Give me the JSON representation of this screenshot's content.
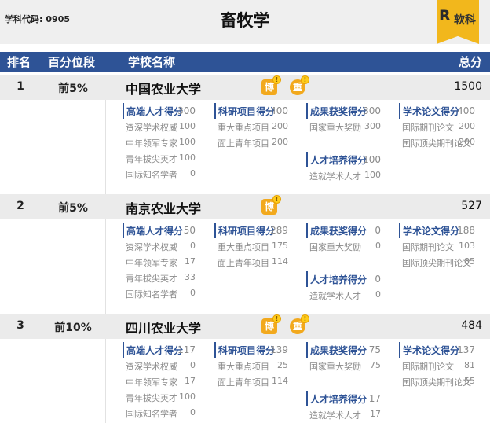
{
  "header": {
    "code_label": "学科代码:",
    "code_value": "0905",
    "title": "畜牧学",
    "logo_text": "软科"
  },
  "columns": {
    "rank": "排名",
    "percentile": "百分位段",
    "school": "学校名称",
    "total": "总分"
  },
  "schools": [
    {
      "rank": "1",
      "percentile": "前5%",
      "name": "中国农业大学",
      "total": "1500",
      "badges": [
        {
          "text": "博",
          "dot": "!"
        },
        {
          "text": "重",
          "dot": "!"
        }
      ],
      "talent": {
        "name": "高端人才得分",
        "score": "300",
        "items": [
          {
            "name": "资深学术权威",
            "score": "100"
          },
          {
            "name": "中年领军专家",
            "score": "100"
          },
          {
            "name": "青年拔尖英才",
            "score": "100"
          },
          {
            "name": "国际知名学者",
            "score": "0"
          }
        ]
      },
      "research": {
        "name": "科研项目得分",
        "score": "400",
        "items": [
          {
            "name": "重大重点项目",
            "score": "200"
          },
          {
            "name": "面上青年项目",
            "score": "200"
          }
        ]
      },
      "award": {
        "name": "成果获奖得分",
        "score": "300",
        "items": [
          {
            "name": "国家重大奖励",
            "score": "300"
          }
        ]
      },
      "training": {
        "name": "人才培养得分",
        "score": "100",
        "items": [
          {
            "name": "造就学术人才",
            "score": "100"
          }
        ]
      },
      "papers": {
        "name": "学术论文得分",
        "score": "400",
        "items": [
          {
            "name": "国际期刊论文",
            "score": "200"
          },
          {
            "name": "国际顶尖期刊论文",
            "score": "200"
          }
        ]
      }
    },
    {
      "rank": "2",
      "percentile": "前5%",
      "name": "南京农业大学",
      "total": "527",
      "badges": [
        {
          "text": "博",
          "dot": "!"
        }
      ],
      "talent": {
        "name": "高端人才得分",
        "score": "50",
        "items": [
          {
            "name": "资深学术权威",
            "score": "0"
          },
          {
            "name": "中年领军专家",
            "score": "17"
          },
          {
            "name": "青年拔尖英才",
            "score": "33"
          },
          {
            "name": "国际知名学者",
            "score": "0"
          }
        ]
      },
      "research": {
        "name": "科研项目得分",
        "score": "289",
        "items": [
          {
            "name": "重大重点项目",
            "score": "175"
          },
          {
            "name": "面上青年项目",
            "score": "114"
          }
        ]
      },
      "award": {
        "name": "成果获奖得分",
        "score": "0",
        "items": [
          {
            "name": "国家重大奖励",
            "score": "0"
          }
        ]
      },
      "training": {
        "name": "人才培养得分",
        "score": "0",
        "items": [
          {
            "name": "造就学术人才",
            "score": "0"
          }
        ]
      },
      "papers": {
        "name": "学术论文得分",
        "score": "188",
        "items": [
          {
            "name": "国际期刊论文",
            "score": "103"
          },
          {
            "name": "国际顶尖期刊论文",
            "score": "85"
          }
        ]
      }
    },
    {
      "rank": "3",
      "percentile": "前10%",
      "name": "四川农业大学",
      "total": "484",
      "badges": [
        {
          "text": "博",
          "dot": "!"
        },
        {
          "text": "重",
          "dot": "!"
        }
      ],
      "talent": {
        "name": "高端人才得分",
        "score": "117",
        "items": [
          {
            "name": "资深学术权威",
            "score": "0"
          },
          {
            "name": "中年领军专家",
            "score": "17"
          },
          {
            "name": "青年拔尖英才",
            "score": "100"
          },
          {
            "name": "国际知名学者",
            "score": "0"
          }
        ]
      },
      "research": {
        "name": "科研项目得分",
        "score": "139",
        "items": [
          {
            "name": "重大重点项目",
            "score": "25"
          },
          {
            "name": "面上青年项目",
            "score": "114"
          }
        ]
      },
      "award": {
        "name": "成果获奖得分",
        "score": "75",
        "items": [
          {
            "name": "国家重大奖励",
            "score": "75"
          }
        ]
      },
      "training": {
        "name": "人才培养得分",
        "score": "17",
        "items": [
          {
            "name": "造就学术人才",
            "score": "17"
          }
        ]
      },
      "papers": {
        "name": "学术论文得分",
        "score": "137",
        "items": [
          {
            "name": "国际期刊论文",
            "score": "81"
          },
          {
            "name": "国际顶尖期刊论文",
            "score": "55"
          }
        ]
      }
    }
  ]
}
